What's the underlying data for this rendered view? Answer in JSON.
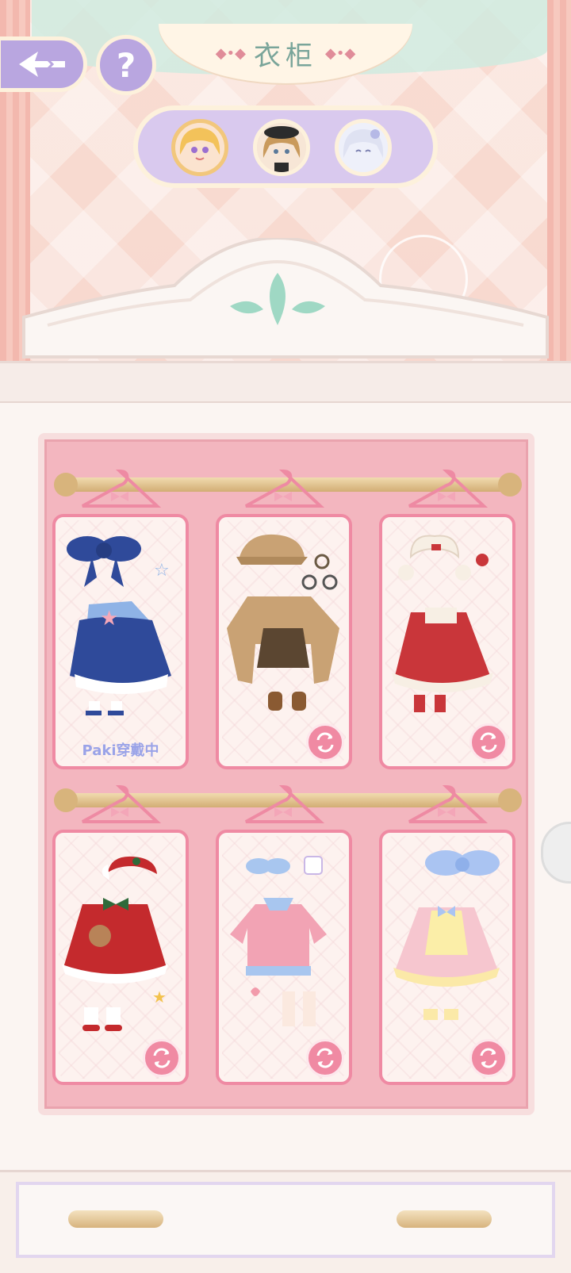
{
  "header": {
    "title": "衣柜",
    "back_icon": "back-arrow-icon",
    "help_label": "?"
  },
  "characters": [
    {
      "name": "character-blonde-girl",
      "selected": true,
      "hair": "#f3c25a"
    },
    {
      "name": "character-beret-girl",
      "selected": false,
      "hair": "#c99a5c"
    },
    {
      "name": "character-silver-girl",
      "selected": false,
      "hair": "#dfe2f2"
    }
  ],
  "wardrobe": {
    "outfits": [
      {
        "id": "blue-sailor-dress",
        "status": "Paki穿戴中",
        "main": "#2f4a9a",
        "accent": "#f6a8b8"
      },
      {
        "id": "detective-coat",
        "status": "",
        "main": "#c9a274",
        "accent": "#5b4631"
      },
      {
        "id": "red-winter-dress",
        "status": "",
        "main": "#c9363a",
        "accent": "#f7efe4"
      },
      {
        "id": "christmas-dress",
        "status": "",
        "main": "#c42a2d",
        "accent": "#2f6a3a"
      },
      {
        "id": "pink-sweater",
        "status": "",
        "main": "#f2a3b4",
        "accent": "#a8c6ef"
      },
      {
        "id": "pastel-lolita-dress",
        "status": "",
        "main": "#f6c6cf",
        "accent": "#aac4f2"
      }
    ]
  },
  "colors": {
    "accent_purple": "#b9a6e0",
    "card_border": "#ef8aa3",
    "interior_pink": "#f3b6bf",
    "mint": "#9fd8c4"
  }
}
